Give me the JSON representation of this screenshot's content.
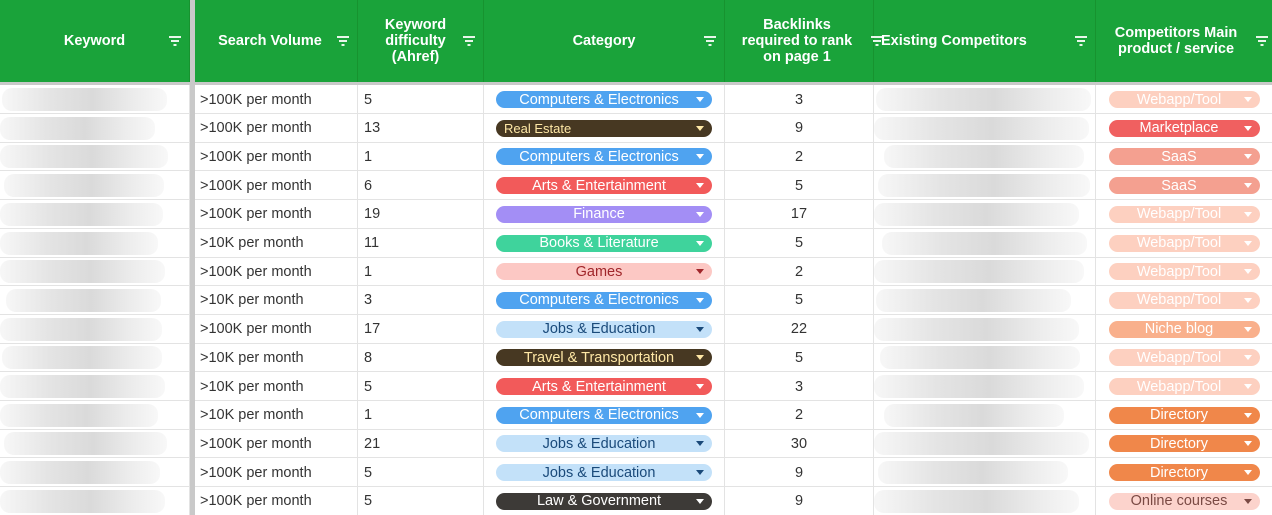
{
  "headers": {
    "keyword": "Keyword",
    "search_volume": "Search Volume",
    "keyword_difficulty": "Keyword\ndifficulty\n(Ahref)",
    "category": "Category",
    "backlinks": "Backlinks\nrequired to rank\non page 1",
    "existing_competitors": "Existing Competitors",
    "competitors_product": "Competitors Main\nproduct / service"
  },
  "colors": {
    "header_bg": "#1aa33a",
    "Computers & Electronics": {
      "bg": "#4fa3f0",
      "fg": "#ffffff"
    },
    "Real Estate": {
      "bg": "#473822",
      "fg": "#ffe8a6"
    },
    "Arts & Entertainment": {
      "bg": "#f25a5a",
      "fg": "#ffffff"
    },
    "Finance": {
      "bg": "#a38ef5",
      "fg": "#ffffff"
    },
    "Books & Literature": {
      "bg": "#3fd39c",
      "fg": "#ffffff"
    },
    "Games": {
      "bg": "#fcc8c4",
      "fg": "#a0262a"
    },
    "Jobs & Education": {
      "bg": "#c3e1f9",
      "fg": "#1a4a7a"
    },
    "Travel & Transportation": {
      "bg": "#473822",
      "fg": "#ffe8a6"
    },
    "Law & Government": {
      "bg": "#3d3a37",
      "fg": "#ffffff"
    },
    "Webapp/Tool": {
      "bg": "#fdd0c0",
      "fg": "#ffffff"
    },
    "Marketplace": {
      "bg": "#f06060",
      "fg": "#ffffff"
    },
    "SaaS": {
      "bg": "#f4a090",
      "fg": "#ffffff"
    },
    "Niche blog": {
      "bg": "#f9b08c",
      "fg": "#ffffff"
    },
    "Directory": {
      "bg": "#f0874a",
      "fg": "#ffffff"
    },
    "Online courses": {
      "bg": "#fcd3cc",
      "fg": "#7a4a44"
    }
  },
  "rows": [
    {
      "search_volume": ">100K per month",
      "difficulty": "5",
      "category": "Computers & Electronics",
      "backlinks": "3",
      "product": "Webapp/Tool"
    },
    {
      "search_volume": ">100K per month",
      "difficulty": "13",
      "category": "Real Estate",
      "backlinks": "9",
      "product": "Marketplace"
    },
    {
      "search_volume": ">100K per month",
      "difficulty": "1",
      "category": "Computers & Electronics",
      "backlinks": "2",
      "product": "SaaS"
    },
    {
      "search_volume": ">100K per month",
      "difficulty": "6",
      "category": "Arts & Entertainment",
      "backlinks": "5",
      "product": "SaaS"
    },
    {
      "search_volume": ">100K per month",
      "difficulty": "19",
      "category": "Finance",
      "backlinks": "17",
      "product": "Webapp/Tool"
    },
    {
      "search_volume": ">10K per month",
      "difficulty": "11",
      "category": "Books & Literature",
      "backlinks": "5",
      "product": "Webapp/Tool"
    },
    {
      "search_volume": ">100K per month",
      "difficulty": "1",
      "category": "Games",
      "backlinks": "2",
      "product": "Webapp/Tool"
    },
    {
      "search_volume": ">10K per month",
      "difficulty": "3",
      "category": "Computers & Electronics",
      "backlinks": "5",
      "product": "Webapp/Tool"
    },
    {
      "search_volume": ">100K per month",
      "difficulty": "17",
      "category": "Jobs & Education",
      "backlinks": "22",
      "product": "Niche blog"
    },
    {
      "search_volume": ">10K per month",
      "difficulty": "8",
      "category": "Travel & Transportation",
      "backlinks": "5",
      "product": "Webapp/Tool"
    },
    {
      "search_volume": ">10K per month",
      "difficulty": "5",
      "category": "Arts & Entertainment",
      "backlinks": "3",
      "product": "Webapp/Tool"
    },
    {
      "search_volume": ">10K per month",
      "difficulty": "1",
      "category": "Computers & Electronics",
      "backlinks": "2",
      "product": "Directory"
    },
    {
      "search_volume": ">100K per month",
      "difficulty": "21",
      "category": "Jobs & Education",
      "backlinks": "30",
      "product": "Directory"
    },
    {
      "search_volume": ">100K per month",
      "difficulty": "5",
      "category": "Jobs & Education",
      "backlinks": "9",
      "product": "Directory"
    },
    {
      "search_volume": ">100K per month",
      "difficulty": "5",
      "category": "Law & Government",
      "backlinks": "9",
      "product": "Online courses"
    }
  ]
}
